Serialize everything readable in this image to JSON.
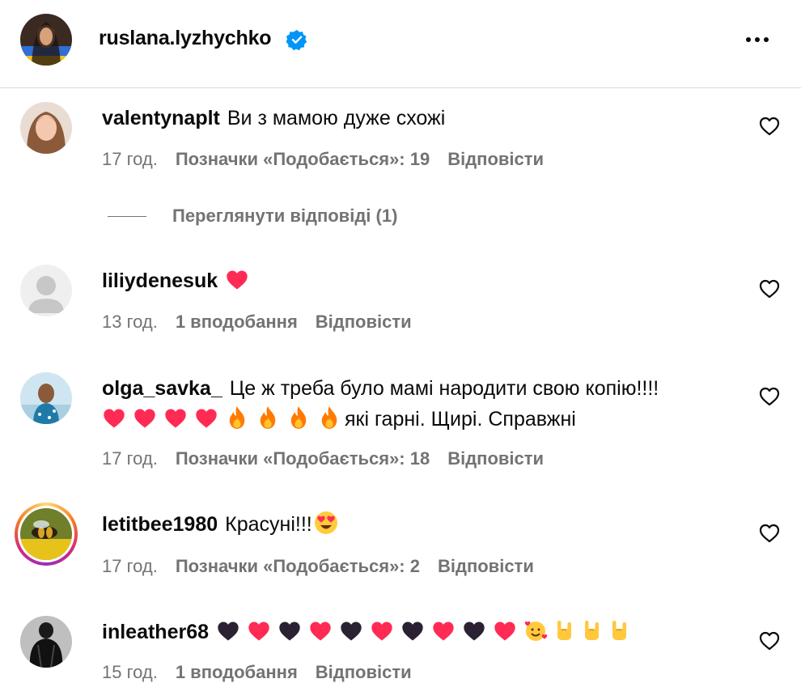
{
  "header": {
    "username": "ruslana.lyzhychko",
    "verified_icon": "verified-badge-icon",
    "more_icon": "more-options-icon"
  },
  "comments": [
    {
      "username": "valentynaplt",
      "text": "Ви з мамою дуже схожі",
      "time": "17 год.",
      "likes": "Позначки «Подобається»: 19",
      "reply": "Відповісти",
      "view_replies": "Переглянути відповіді (1)"
    },
    {
      "username": "liliydenesuk",
      "text": "",
      "emoji": [
        "red-heart"
      ],
      "time": "13 год.",
      "likes": "1 вподобання",
      "reply": "Відповісти"
    },
    {
      "username": "olga_savka_",
      "text": "Це ж треба було мамі народити свою копію!!!!",
      "text2": "які гарні. Щирі. Справжні",
      "emoji_line2": [
        "red-heart",
        "red-heart",
        "red-heart",
        "red-heart",
        "fire",
        "fire",
        "fire",
        "fire"
      ],
      "time": "17 год.",
      "likes": "Позначки «Подобається»: 18",
      "reply": "Відповісти"
    },
    {
      "username": "letitbee1980",
      "text": "Красуні!!!",
      "emoji": [
        "heart-eyes"
      ],
      "time": "17 год.",
      "likes": "Позначки «Подобається»: 2",
      "reply": "Відповісти"
    },
    {
      "username": "inleather68",
      "text": "",
      "emoji": [
        "black-heart",
        "red-heart",
        "black-heart",
        "red-heart",
        "black-heart",
        "red-heart",
        "black-heart",
        "red-heart",
        "black-heart",
        "red-heart",
        "smiling-hearts",
        "rock-on",
        "rock-on",
        "rock-on"
      ],
      "time": "15 год.",
      "likes": "1 вподобання",
      "reply": "Відповісти"
    }
  ],
  "colors": {
    "text": "#0a0a0a",
    "muted": "#737373",
    "verified": "#0095f6",
    "heart": "#ff2b55",
    "story_ring_a": "#feda75",
    "story_ring_b": "#d62976"
  }
}
